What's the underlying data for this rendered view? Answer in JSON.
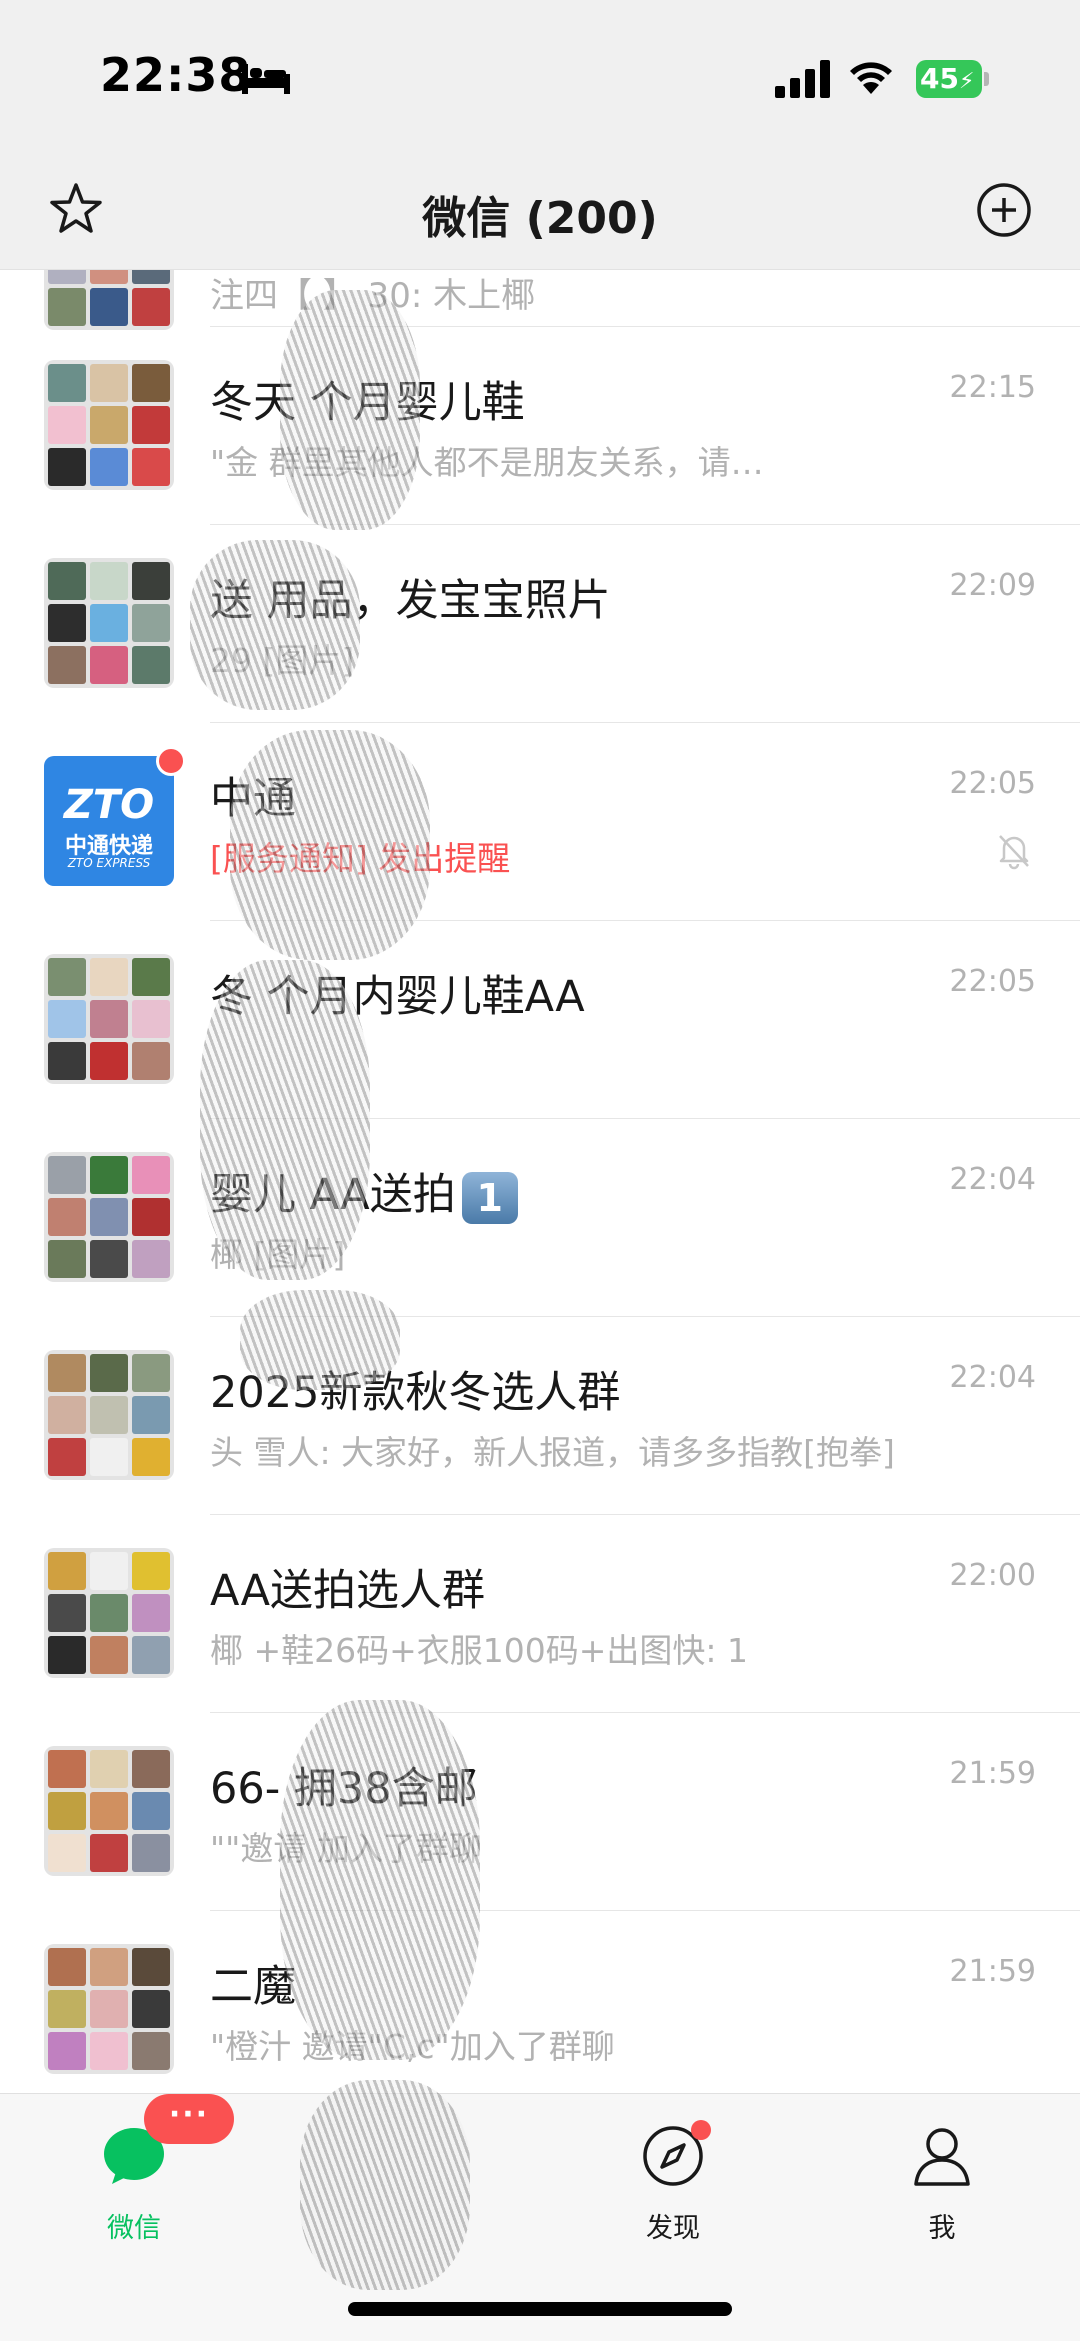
{
  "status_bar": {
    "time": "22:38",
    "battery": "45"
  },
  "nav": {
    "title": "微信 (200)"
  },
  "partial_row": {
    "message": "注四【 】 30: 木上椰"
  },
  "chats": [
    {
      "title": "冬天      个月婴儿鞋",
      "time": "22:15",
      "message": "\"金      群里其他人都不是朋友关系，请…",
      "avatar": [
        "#6b8f8a",
        "#d9c3a5",
        "#7a5c3c",
        "#f2c0d0",
        "#c9a86b",
        "#c23a3a",
        "#2a2a2a",
        "#5a8bd6",
        "#d94a4a"
      ]
    },
    {
      "title": "送      用品，发宝宝照片",
      "time": "22:09",
      "message": "29      [图片]",
      "avatar": [
        "#4f6a58",
        "#c8d7c9",
        "#3b3f3a",
        "#2d2d2d",
        "#6ab0e0",
        "#8fa39a",
        "#8c7060",
        "#d66080",
        "#5c7a6a"
      ]
    },
    {
      "title": "中通",
      "time": "22:05",
      "message": "[服务通知]      发出提醒",
      "service": true,
      "muted": true,
      "zto": true
    },
    {
      "title": "冬      个月内婴儿鞋AA",
      "time": "22:05",
      "message": "",
      "avatar": [
        "#7a8f70",
        "#e8d6c0",
        "#5a7a4a",
        "#a0c4e8",
        "#c08090",
        "#e8c0d0",
        "#3a3a3a",
        "#c03030",
        "#b08070"
      ]
    },
    {
      "title": "婴儿      AA送拍",
      "time": "22:04",
      "message": "椰      [图片]",
      "badge": "1",
      "avatar": [
        "#9aa0a8",
        "#3a7a3a",
        "#e890b8",
        "#c08070",
        "#8090b0",
        "#b03030",
        "#6a7a5a",
        "#4a4a4a",
        "#c0a0c0"
      ]
    },
    {
      "title": "2025新款秋冬选人群",
      "time": "22:04",
      "message": "头      雪人: 大家好，新人报道，请多多指教[抱拳]",
      "avatar": [
        "#b08a60",
        "#5a6a4a",
        "#8a9a80",
        "#d0b0a0",
        "#c0c0b0",
        "#7a9ab0",
        "#c04040",
        "#f0f0f0",
        "#e0b030"
      ]
    },
    {
      "title": "AA送拍选人群",
      "time": "22:00",
      "message": "椰      +鞋26码+衣服100码+出图快: 1",
      "avatar": [
        "#d0a040",
        "#f0f0f0",
        "#e0c030",
        "#4a4a4a",
        "#6a8a6a",
        "#c090c0",
        "#2a2a2a",
        "#c08060",
        "#90a0b0"
      ]
    },
    {
      "title": "66-      拥38含邮",
      "time": "21:59",
      "message": "\"\"邀请      加入了群聊",
      "avatar": [
        "#c07050",
        "#e0d0b0",
        "#8a6a5a",
        "#c0a040",
        "#d09060",
        "#6a8ab0",
        "#f0e0d0",
        "#c04040",
        "#8a90a0"
      ]
    },
    {
      "title": "二魔",
      "time": "21:59",
      "message": "\"橙汁      邀请\"C,c\"加入了群聊",
      "avatar": [
        "#b07050",
        "#d0a080",
        "#5a4a3a",
        "#c0b060",
        "#e0b0b0",
        "#3a3a3a",
        "#c080c0",
        "#f0c0d0",
        "#8a7a70"
      ]
    }
  ],
  "tabs": [
    {
      "label": "微信",
      "badge": "···"
    },
    {
      "label": "发现"
    },
    {
      "label": "我"
    }
  ]
}
